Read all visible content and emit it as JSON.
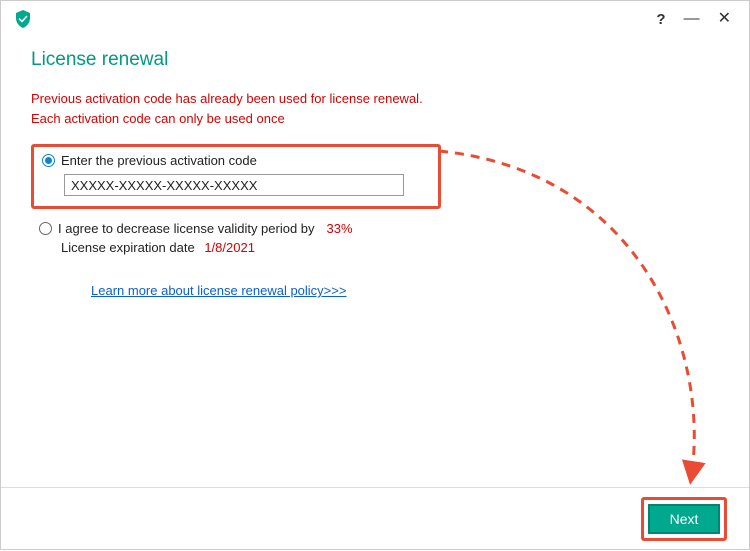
{
  "header": {
    "title": "License renewal"
  },
  "error": {
    "line1": "Previous activation code has already been used for license renewal.",
    "line2": "Each activation code can only be used once"
  },
  "option1": {
    "label": "Enter the previous activation code",
    "input_value": "XXXXX-XXXXX-XXXXX-XXXXX"
  },
  "option2": {
    "label": "I agree to decrease license validity period by",
    "percent": "33%",
    "expiration_label": "License expiration date",
    "expiration_date": "1/8/2021"
  },
  "link": {
    "text": "Learn more about license renewal policy>>>"
  },
  "footer": {
    "next_label": "Next"
  },
  "titlebar": {
    "help": "?",
    "minimize": "—",
    "close": "✕"
  }
}
